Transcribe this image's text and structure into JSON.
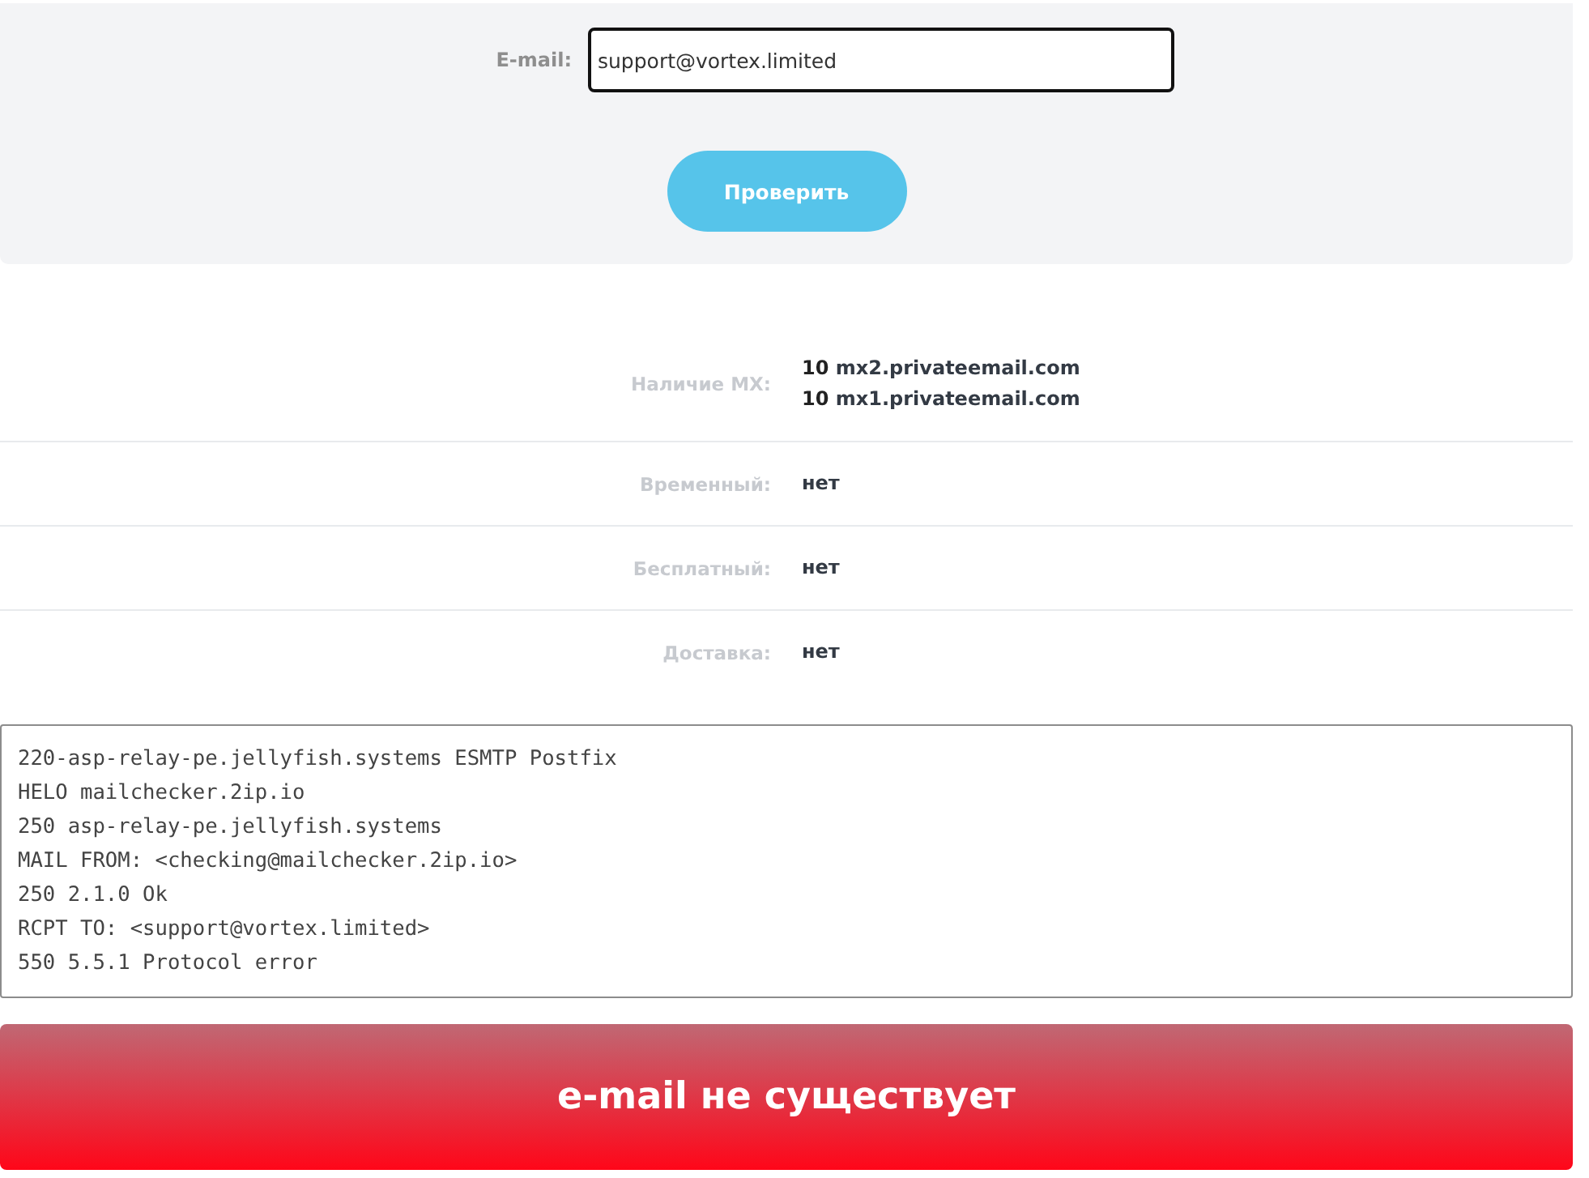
{
  "form": {
    "email_label": "E-mail:",
    "email_value": "support@vortex.limited",
    "email_focused": true,
    "submit_button": "Проверить"
  },
  "results": [
    {
      "label": "Наличие MX:",
      "values": [
        "**10** mx2.privateemail.com",
        "**10** mx1.privateemail.com"
      ]
    },
    {
      "label": "Временный:",
      "values": [
        "нет"
      ]
    },
    {
      "label": "Бесплатный:",
      "values": [
        "нет"
      ]
    },
    {
      "label": "Доставка:",
      "values": [
        "нет"
      ]
    }
  ],
  "smtp_log": [
    "220-asp-relay-pe.jellyfish.systems ESMTP Postfix",
    "HELO mailchecker.2ip.io",
    "250 asp-relay-pe.jellyfish.systems",
    "MAIL FROM: <checking@mailchecker.2ip.io>",
    "250 2.1.0 Ok",
    "RCPT TO: <support@vortex.limited>",
    "550 5.5.1 Protocol error"
  ],
  "verdict": {
    "kind": "error",
    "text": "e-mail не существует"
  }
}
